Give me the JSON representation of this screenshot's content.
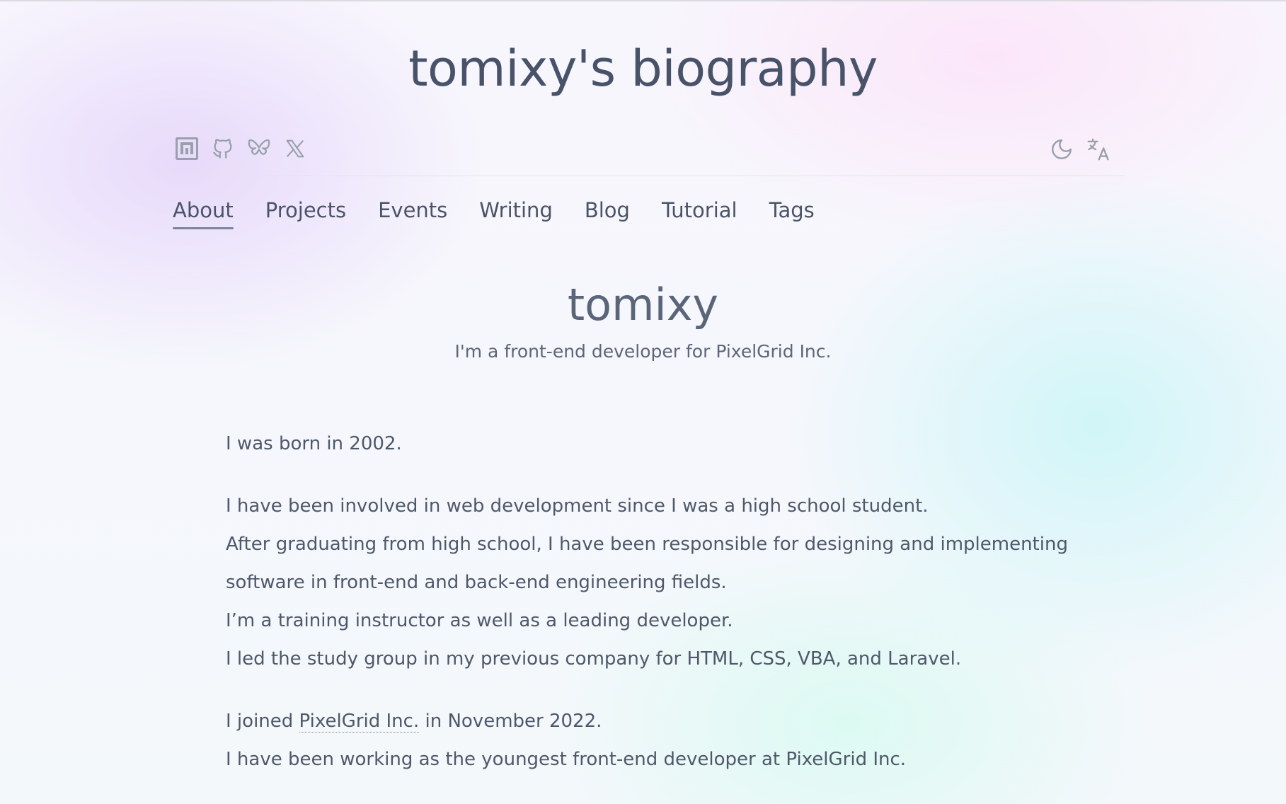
{
  "site": {
    "title": "tomixy's biography"
  },
  "social_links": [
    {
      "name": "note-icon",
      "label": "note"
    },
    {
      "name": "github-icon",
      "label": "GitHub"
    },
    {
      "name": "bluesky-icon",
      "label": "Bluesky"
    },
    {
      "name": "x-icon",
      "label": "X"
    }
  ],
  "utility": [
    {
      "name": "dark-mode-icon"
    },
    {
      "name": "translate-icon"
    }
  ],
  "nav": {
    "tabs": [
      {
        "label": "About",
        "active": true
      },
      {
        "label": "Projects",
        "active": false
      },
      {
        "label": "Events",
        "active": false
      },
      {
        "label": "Writing",
        "active": false
      },
      {
        "label": "Blog",
        "active": false
      },
      {
        "label": "Tutorial",
        "active": false
      },
      {
        "label": "Tags",
        "active": false
      }
    ]
  },
  "profile": {
    "name": "tomixy",
    "tagline": "I'm a front-end developer for PixelGrid Inc."
  },
  "bio": {
    "p1": "I was born in 2002.",
    "p2": [
      "I have been involved in web development since I was a high school student.",
      "After graduating from high school, I have been responsible for designing and implementing",
      "software in front-end and back-end engineering fields.",
      "I’m a training instructor as well as a leading developer.",
      "I led the study group in my previous company for HTML, CSS, VBA, and Laravel."
    ],
    "p3_before": "I joined ",
    "p3_link": "PixelGrid Inc.",
    "p3_after": " in November 2022.",
    "p3_line2": "I have been working as the youngest front-end developer at PixelGrid Inc."
  },
  "colors": {
    "text": "#4a5468",
    "icon": "#9aa0ab",
    "underline": "#7d8596"
  }
}
